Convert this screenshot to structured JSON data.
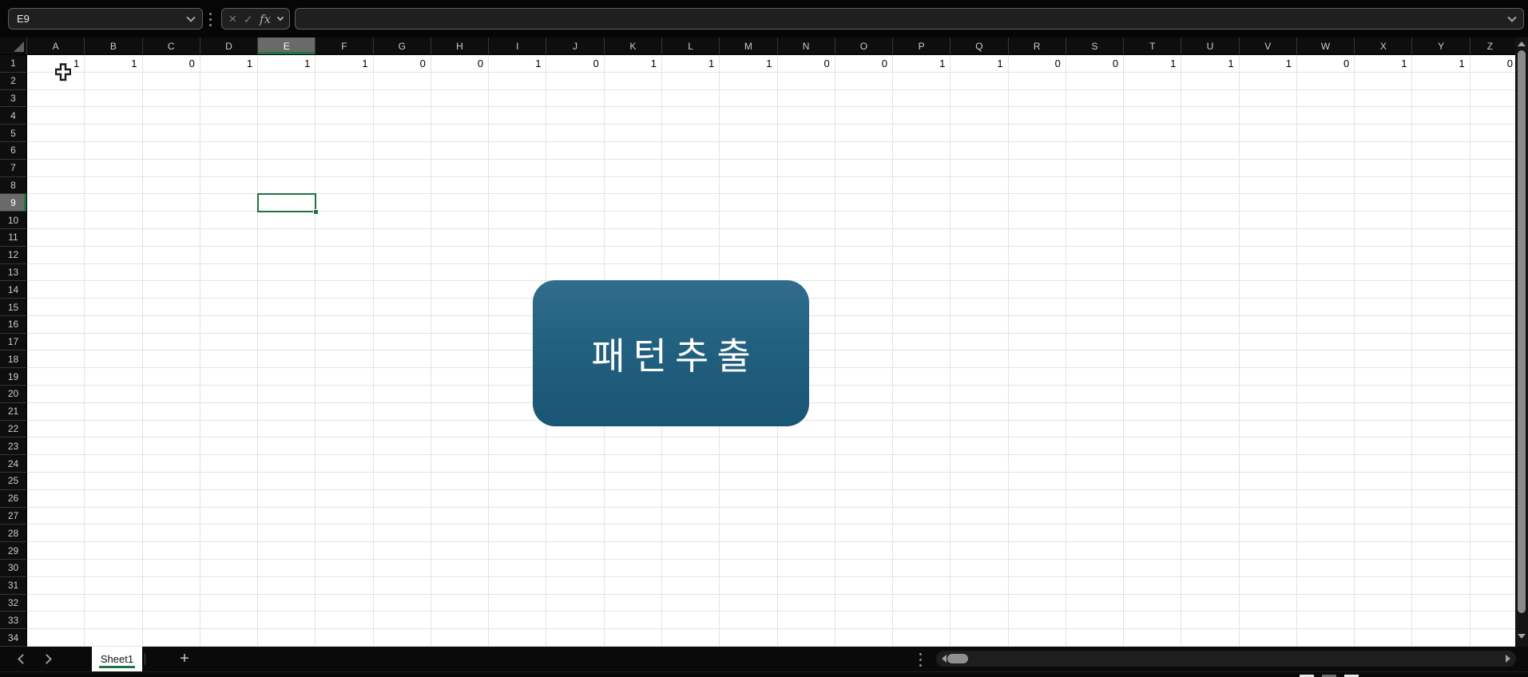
{
  "formula_bar": {
    "name_box_value": "E9",
    "name_box_dropdown_icon": "chevron-down",
    "separator_icon": "vertical-dots",
    "cancel_label": "×",
    "enter_label": "✓",
    "function_label": "fx",
    "function_dropdown_icon": "chevron-down",
    "input_value": "",
    "expand_icon": "chevron-down"
  },
  "grid": {
    "columns": [
      "A",
      "B",
      "C",
      "D",
      "E",
      "F",
      "G",
      "H",
      "I",
      "J",
      "K",
      "L",
      "M",
      "N",
      "O",
      "P",
      "Q",
      "R",
      "S",
      "T",
      "U",
      "V",
      "W",
      "X",
      "Y",
      "Z"
    ],
    "row_count": 34,
    "selected": {
      "column": "E",
      "row": 9,
      "cell_ref": "E9"
    },
    "row1_values": [
      1,
      1,
      0,
      1,
      1,
      1,
      0,
      0,
      1,
      0,
      1,
      1,
      1,
      0,
      0,
      1,
      1,
      0,
      0,
      1,
      1,
      1,
      0,
      1,
      1,
      0
    ]
  },
  "shape_button": {
    "label": "패턴추출"
  },
  "sheet_bar": {
    "prev_icon": "chevron-left",
    "next_icon": "chevron-right",
    "tabs": [
      {
        "label": "Sheet1",
        "active": true
      }
    ],
    "add_tab_label": "+",
    "scroll_handle_icon": "vertical-dots"
  },
  "scrollbars": {
    "vertical": {
      "up_icon": "triangle-up",
      "down_icon": "triangle-down"
    },
    "horizontal": {
      "left_icon": "triangle-left",
      "right_icon": "triangle-right"
    }
  },
  "colors": {
    "accent_green": "#217346",
    "selected_header_bg": "#6a6a6a",
    "button_gradient_top": "#306d8c",
    "button_gradient_bottom": "#195574",
    "chrome_bg": "#060606",
    "gridline": "#e3e3e3"
  }
}
